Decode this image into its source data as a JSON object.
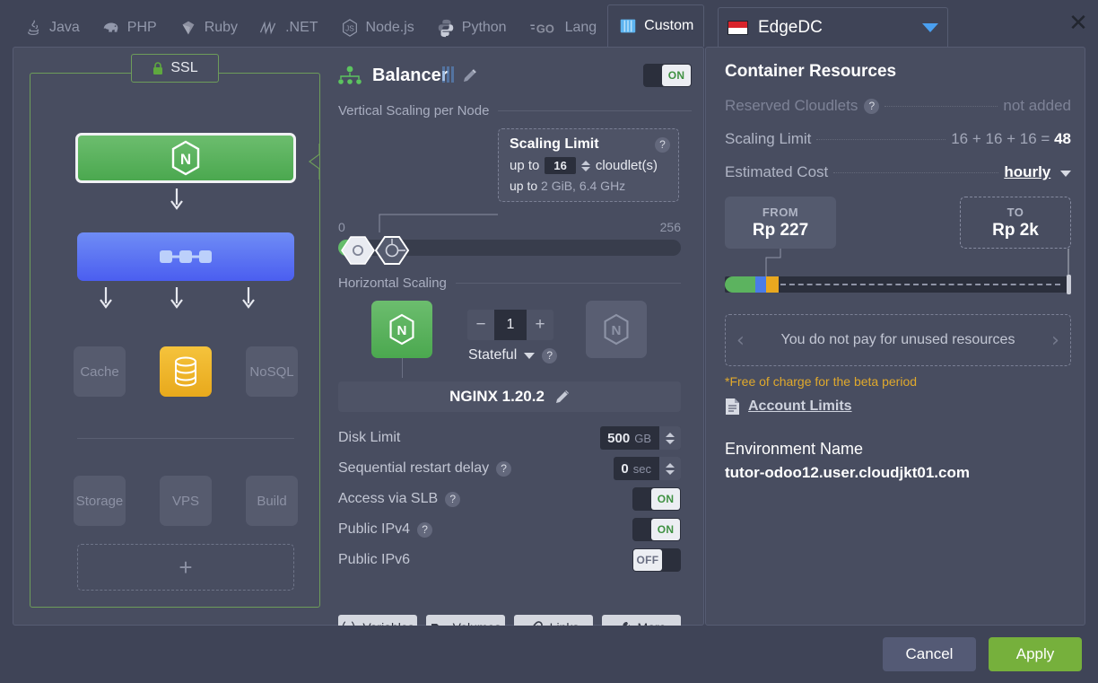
{
  "tabs": [
    {
      "label": "Java",
      "icon": "java-icon",
      "active": false
    },
    {
      "label": "PHP",
      "icon": "php-elephant-icon",
      "active": false
    },
    {
      "label": "Ruby",
      "icon": "ruby-icon",
      "active": false
    },
    {
      "label": ".NET",
      "icon": "dotnet-icon",
      "active": false
    },
    {
      "label": "Node.js",
      "icon": "nodejs-icon",
      "active": false
    },
    {
      "label": "Python",
      "icon": "python-icon",
      "active": false
    },
    {
      "label": "Lang",
      "icon": "go-lang-icon",
      "active": false
    },
    {
      "label": "Custom",
      "icon": "custom-icon",
      "active": true
    }
  ],
  "region_tab": {
    "label": "EdgeDC",
    "flag": "indonesia-flag-icon",
    "caret": "chevron-down-icon",
    "close": "close-icon"
  },
  "topology": {
    "ssl_label": "SSL",
    "ssl_icon": "lock-icon",
    "balancer_node": "nginx-icon",
    "app_node": "app-servers-icon",
    "databases": [
      {
        "label": "Cache",
        "active": false
      },
      {
        "label": "",
        "active": true,
        "icon": "sql-database-icon"
      },
      {
        "label": "NoSQL",
        "active": false
      }
    ],
    "services": [
      {
        "label": "Storage"
      },
      {
        "label": "VPS"
      },
      {
        "label": "Build"
      }
    ],
    "add_label": "+"
  },
  "settings": {
    "title": "Balancer",
    "title_edit_icon": "pencil-icon",
    "power_toggle": "ON",
    "vertical_section": "Vertical Scaling per Node",
    "scaling_limit": {
      "title": "Scaling Limit",
      "help": "?",
      "prefix": "up to",
      "value": "16",
      "unit": "cloudlet(s)",
      "detail_prefix": "up to",
      "detail": "2 GiB, 6.4 GHz"
    },
    "slider": {
      "min": "0",
      "max": "256"
    },
    "horizontal_section": "Horizontal Scaling",
    "node_count": "1",
    "minus": "−",
    "plus": "+",
    "stateful_label": "Stateful",
    "stateful_help": "?",
    "stack_name": "NGINX 1.20.2",
    "stack_edit_icon": "pencil-icon",
    "rows": [
      {
        "label": "Disk Limit",
        "help": false,
        "type": "number",
        "value": "500",
        "unit": "GB"
      },
      {
        "label": "Sequential restart delay",
        "help": true,
        "type": "number",
        "value": "0",
        "unit": "sec"
      },
      {
        "label": "Access via SLB",
        "help": true,
        "type": "toggle",
        "state": "ON"
      },
      {
        "label": "Public IPv4",
        "help": true,
        "type": "toggle",
        "state": "ON"
      },
      {
        "label": "Public IPv6",
        "help": false,
        "type": "toggle",
        "state": "OFF"
      }
    ],
    "buttons": [
      {
        "label": "Variables",
        "icon": "variables-icon"
      },
      {
        "label": "Volumes",
        "icon": "volumes-icon"
      },
      {
        "label": "Links",
        "icon": "links-icon"
      },
      {
        "label": "More",
        "icon": "wrench-icon"
      }
    ]
  },
  "resources": {
    "title": "Container Resources",
    "reserved_label": "Reserved Cloudlets",
    "reserved_help": "?",
    "reserved_value": "not added",
    "scaling_label": "Scaling Limit",
    "scaling_calc": "16 + 16 + 16 =",
    "scaling_total": "48",
    "cost_label": "Estimated Cost",
    "cost_period": "hourly",
    "cost_caret": "chevron-down-icon",
    "from_caption": "FROM",
    "from_amount": "Rp 227",
    "to_caption": "TO",
    "to_amount": "Rp 2k",
    "promo_text": "You do not pay for unused resources",
    "promo_prev": "‹",
    "promo_next": "›",
    "beta_note": "*Free of charge for the beta period",
    "account_limits": "Account Limits",
    "account_limits_icon": "document-icon",
    "env_title": "Environment Name",
    "env_name": "tutor-odoo12.user.cloudjkt01.com"
  },
  "footer": {
    "cancel": "Cancel",
    "apply": "Apply"
  },
  "colors": {
    "accent_green": "#76b03c",
    "node_green": "#4ba84f",
    "node_blue": "#4b5ef0",
    "db_yellow": "#e8a91c",
    "beta_orange": "#e0a92c",
    "panel_bg": "#484d60",
    "app_bg": "#3f4457"
  }
}
